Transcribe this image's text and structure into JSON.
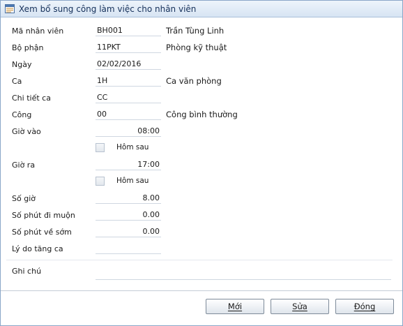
{
  "window": {
    "title": "Xem bổ sung công làm việc cho nhân viên"
  },
  "form": {
    "employee_code": {
      "label": "Mã nhân viên",
      "value": "BH001",
      "desc": "Trần Tùng Linh"
    },
    "department": {
      "label": "Bộ phận",
      "value": "11PKT",
      "desc": "Phòng kỹ thuật"
    },
    "date": {
      "label": "Ngày",
      "value": "02/02/2016"
    },
    "shift": {
      "label": "Ca",
      "value": "1H",
      "desc": "Ca văn phòng"
    },
    "shift_detail": {
      "label": "Chi tiết ca",
      "value": "CC"
    },
    "work_type": {
      "label": "Công",
      "value": "00",
      "desc": "Công bình thường"
    },
    "time_in": {
      "label": "Giờ vào",
      "value": "08:00",
      "next_day_label": "Hôm sau",
      "next_day_checked": false
    },
    "time_out": {
      "label": "Giờ ra",
      "value": "17:00",
      "next_day_label": "Hôm sau",
      "next_day_checked": false
    },
    "hours": {
      "label": "Số giờ",
      "value": "8.00"
    },
    "late_minutes": {
      "label": "Số phút đi muộn",
      "value": "0.00"
    },
    "early_minutes": {
      "label": "Số phút về sớm",
      "value": "0.00"
    },
    "overtime_reason": {
      "label": "Lý do tăng ca",
      "value": ""
    },
    "note": {
      "label": "Ghi chú",
      "value": ""
    }
  },
  "buttons": {
    "new": {
      "label": "Mới",
      "mnemonic": "M"
    },
    "edit": {
      "label": "Sửa",
      "mnemonic": "S"
    },
    "close": {
      "label": "Đóng",
      "mnemonic": "Đ"
    }
  }
}
